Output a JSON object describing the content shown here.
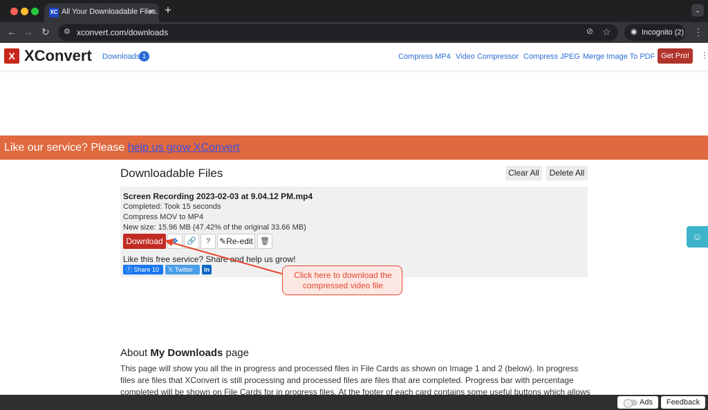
{
  "browser": {
    "tab_favicon": "XC",
    "tab_title": "All Your Downloadable Files.",
    "tab_close": "×",
    "new_tab": "+",
    "url": "xconvert.com/downloads",
    "incognito_label": "Incognito (2)"
  },
  "header": {
    "logo_mark": "X",
    "logo_text": "XConvert",
    "downloads_label": "Downloads",
    "downloads_count": "1",
    "nav_links": [
      "Compress MP4",
      "Video Compressor",
      "Compress JPEG",
      "Merge Image To PDF"
    ],
    "get_pro": "Get Pro!"
  },
  "banner": {
    "text": "Like our service? Please ",
    "link": "help us grow XConvert",
    "bg_color": "#e0693f"
  },
  "main": {
    "title": "Downloadable Files",
    "clear_all": "Clear All",
    "delete_all": "Delete All"
  },
  "file_card": {
    "name": "Screen Recording 2023-02-03 at 9.04.12 PM.mp4",
    "status": "Completed: Took 15 seconds",
    "operation": "Compress MOV to MP4",
    "new_size": "New size: 15.96 MB (47.42% of the original 33.66 MB)",
    "download_label": "Download",
    "reedit_label": "Re-edit",
    "share_prompt": "Like this free service? Share and help us grow!",
    "fb_label": "Share 10",
    "twitter_label": "Twitter",
    "linkedin_label": "in"
  },
  "callout": {
    "text": "Click here to download the compressed video file",
    "color": "#e4472f"
  },
  "about": {
    "title_prefix": "About ",
    "title_bold": "My Downloads",
    "title_suffix": " page",
    "text": "This page will show you all the in progress and processed files in File Cards as shown on Image 1 and 2 (below). In progress files are files that XConvert is still processing and processed files are files that are completed. Progress bar with percentage completed will be shown on File Cards for in progress files. At the footer of each card contains some useful buttons which allows you to"
  },
  "bottom_bar": {
    "ads_label": "Ads",
    "feedback_label": "Feedback"
  }
}
